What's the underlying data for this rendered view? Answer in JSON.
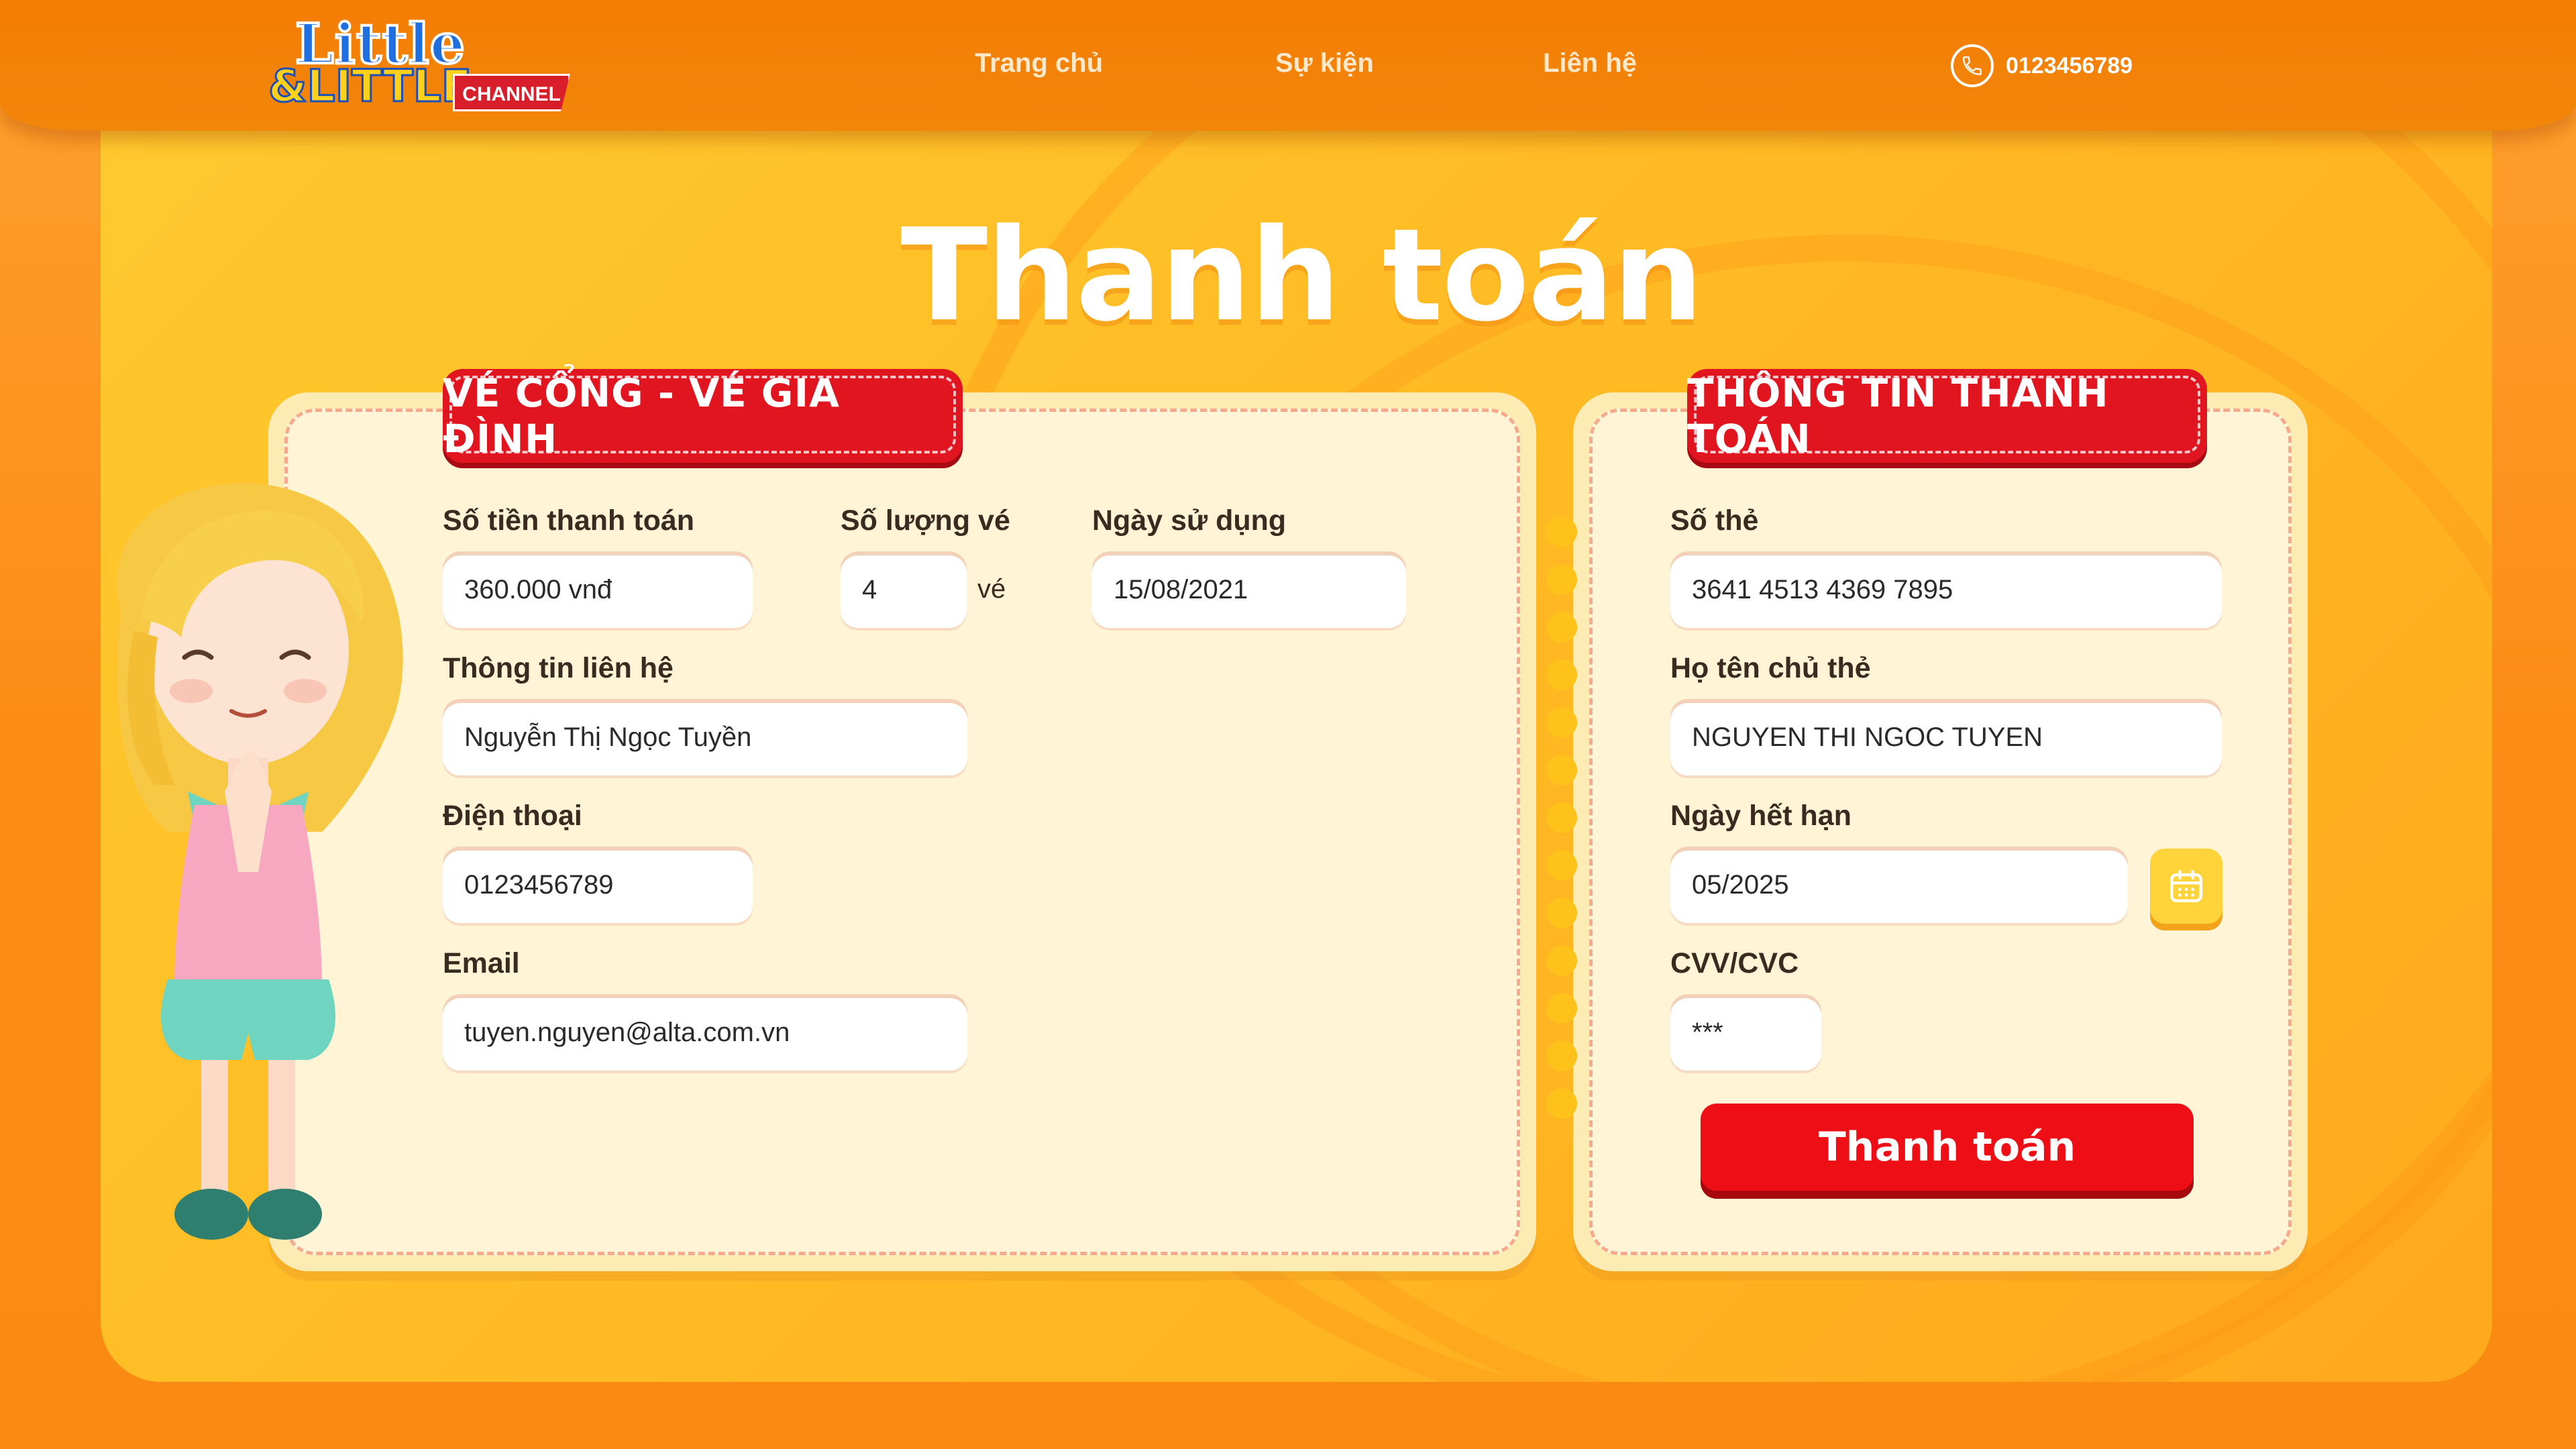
{
  "header": {
    "logo": {
      "line1": "Little",
      "line2": "&LITTLE",
      "badge": "CHANNEL"
    },
    "nav": [
      {
        "label": "Trang chủ"
      },
      {
        "label": "Sự kiện"
      },
      {
        "label": "Liên hệ"
      }
    ],
    "phone": "0123456789"
  },
  "page_title": "Thanh toán",
  "ticket": {
    "ribbon": "VÉ CỔNG - VÉ GIA ĐÌNH",
    "amount_label": "Số tiền thanh toán",
    "amount_value": "360.000 vnđ",
    "quantity_label": "Số lượng vé",
    "quantity_value": "4",
    "quantity_unit": "vé",
    "date_label": "Ngày sử dụng",
    "date_value": "15/08/2021",
    "contact_label": "Thông tin liên hệ",
    "contact_value": "Nguyễn Thị Ngọc Tuyền",
    "phone_label": "Điện thoại",
    "phone_value": "0123456789",
    "email_label": "Email",
    "email_value": "tuyen.nguyen@alta.com.vn"
  },
  "payment": {
    "ribbon": "THÔNG TIN THANH TOÁN",
    "card_number_label": "Số thẻ",
    "card_number_value": "3641 4513 4369 7895",
    "holder_label": "Họ tên chủ thẻ",
    "holder_value": "NGUYEN THI NGOC TUYEN",
    "expiry_label": "Ngày hết hạn",
    "expiry_value": "05/2025",
    "cvv_label": "CVV/CVC",
    "cvv_value": "***",
    "submit_label": "Thanh toán"
  },
  "colors": {
    "header": "#f47d05",
    "panel": "#ffbb24",
    "ribbon": "#e01520",
    "card": "#fff5d6",
    "button": "#ee0f16",
    "calendar_button": "#ffd43a"
  },
  "icons": {
    "phone": "phone-icon",
    "calendar": "calendar-icon",
    "mascot": "child-mascot"
  }
}
